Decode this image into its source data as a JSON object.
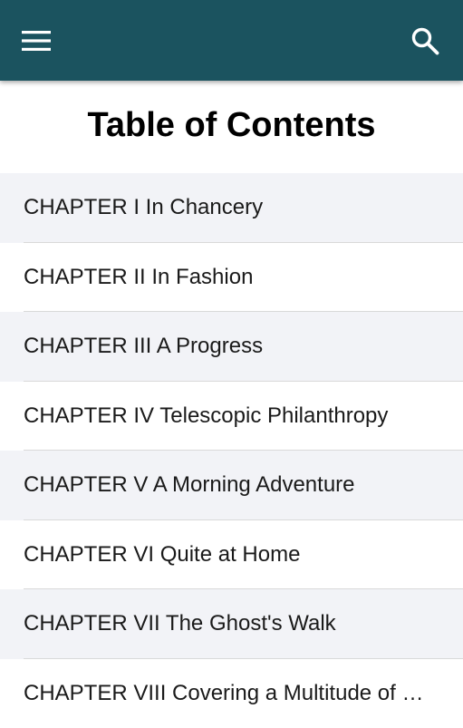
{
  "app_bar": {
    "background": "#1b535f",
    "menu_icon": "hamburger-menu-icon",
    "search_icon": "search-icon"
  },
  "page": {
    "title": "Table of Contents"
  },
  "chapters": [
    {
      "label": "CHAPTER I In Chancery"
    },
    {
      "label": "CHAPTER II In Fashion"
    },
    {
      "label": "CHAPTER III A Progress"
    },
    {
      "label": "CHAPTER IV Telescopic Philanthropy"
    },
    {
      "label": "CHAPTER V A Morning Adventure"
    },
    {
      "label": "CHAPTER VI Quite at Home"
    },
    {
      "label": "CHAPTER VII The Ghost's Walk"
    },
    {
      "label": "CHAPTER VIII Covering a Multitude of Sins"
    }
  ]
}
